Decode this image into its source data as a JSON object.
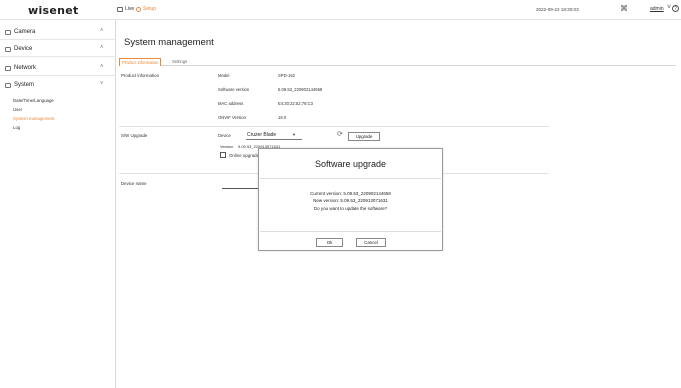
{
  "header": {
    "logo": "wisenet",
    "live_label": "Live",
    "setup_label": "Setup",
    "datetime": "2022-09-22 18:30:03",
    "user": "admin",
    "icons": [
      "monitor-icon",
      "gear-icon",
      "network-status-icon",
      "help-icon",
      "power-icon"
    ]
  },
  "sidebar": {
    "items": [
      {
        "label": "Camera",
        "icon": "camera-icon"
      },
      {
        "label": "Device",
        "icon": "device-icon"
      },
      {
        "label": "Network",
        "icon": "network-icon"
      },
      {
        "label": "System",
        "icon": "system-icon"
      }
    ],
    "system_sub": [
      {
        "label": "Date/Time/Language",
        "active": false
      },
      {
        "label": "User",
        "active": false
      },
      {
        "label": "System management",
        "active": true
      },
      {
        "label": "Log",
        "active": false
      }
    ]
  },
  "main": {
    "title": "System management",
    "tabs": [
      {
        "label": "Product information",
        "active": true
      },
      {
        "label": "Settings",
        "active": false
      }
    ],
    "product_info": {
      "section": "Product information",
      "rows": [
        {
          "label": "Model",
          "value": "SPD-152"
        },
        {
          "label": "Software version",
          "value": "5.09.53_220902144658"
        },
        {
          "label": "MAC address",
          "value": "E4:30:22:52:78:C3"
        },
        {
          "label": "ONVIF Version",
          "value": "18.0"
        }
      ]
    },
    "sw_upgrade": {
      "section": "S/W Upgrade",
      "device_label": "Device",
      "device_value": "Cruzer Blade",
      "upgrade_button": "Upgrade",
      "version_label": "Version",
      "version_value": "5.09.53_220913071631",
      "online_label": "Online upgrade"
    },
    "device_name": {
      "section": "Device name"
    }
  },
  "dialog": {
    "title": "Software upgrade",
    "current_version": "Current version: 5.09.53_220902144658",
    "new_version": "New version: 5.09.53_220913071631",
    "question": "Do you want to update the software?",
    "ok_label": "Ok",
    "cancel_label": "Cancel"
  },
  "colors": {
    "accent": "#e98a3b",
    "border": "#d9d9d9"
  }
}
